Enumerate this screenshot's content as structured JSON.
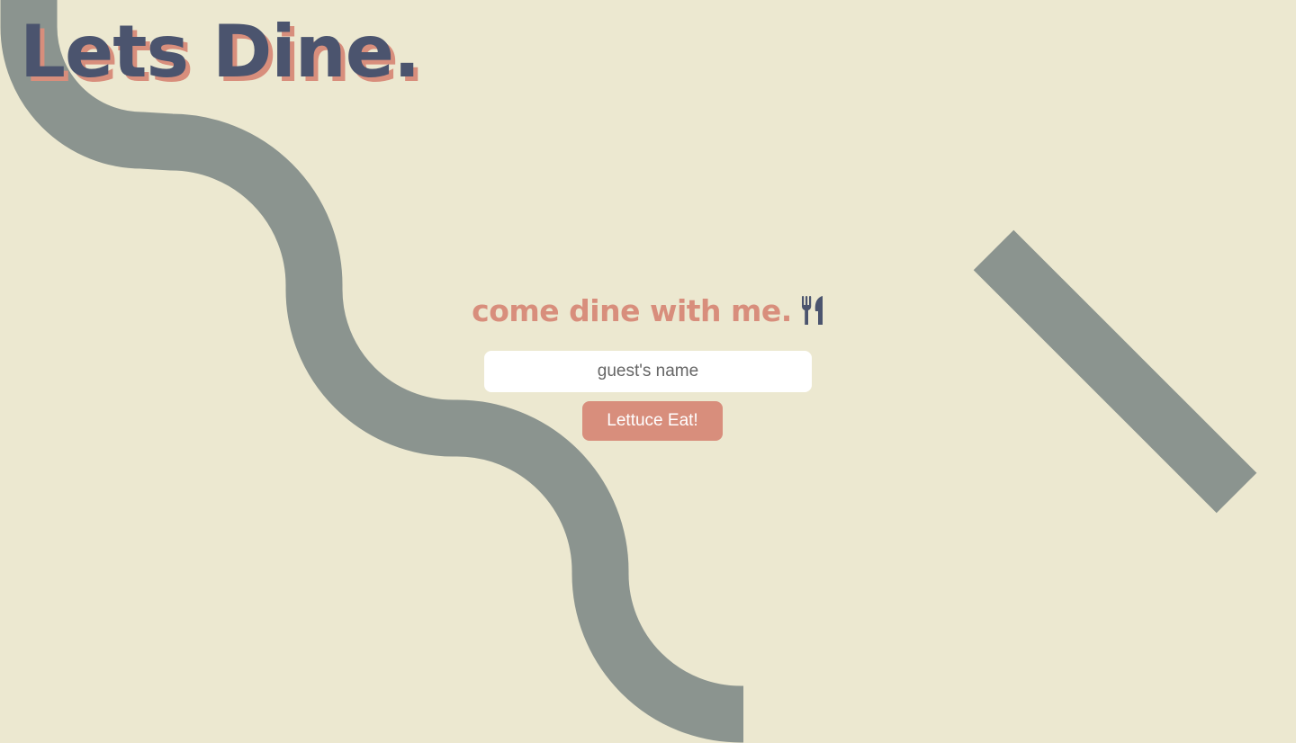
{
  "header": {
    "logo_text": "Lets Dine."
  },
  "main": {
    "tagline": "come dine with me.",
    "tagline_icon": "utensils-icon",
    "guest_input": {
      "placeholder": "guest's name",
      "value": ""
    },
    "submit_label": "Lettuce Eat!"
  },
  "colors": {
    "background": "#ece8d0",
    "navy": "#4b546e",
    "salmon": "#d88e7c",
    "slate_gray": "#8b948f",
    "input_background": "#ffffff"
  },
  "icons": [
    "utensils-icon"
  ]
}
